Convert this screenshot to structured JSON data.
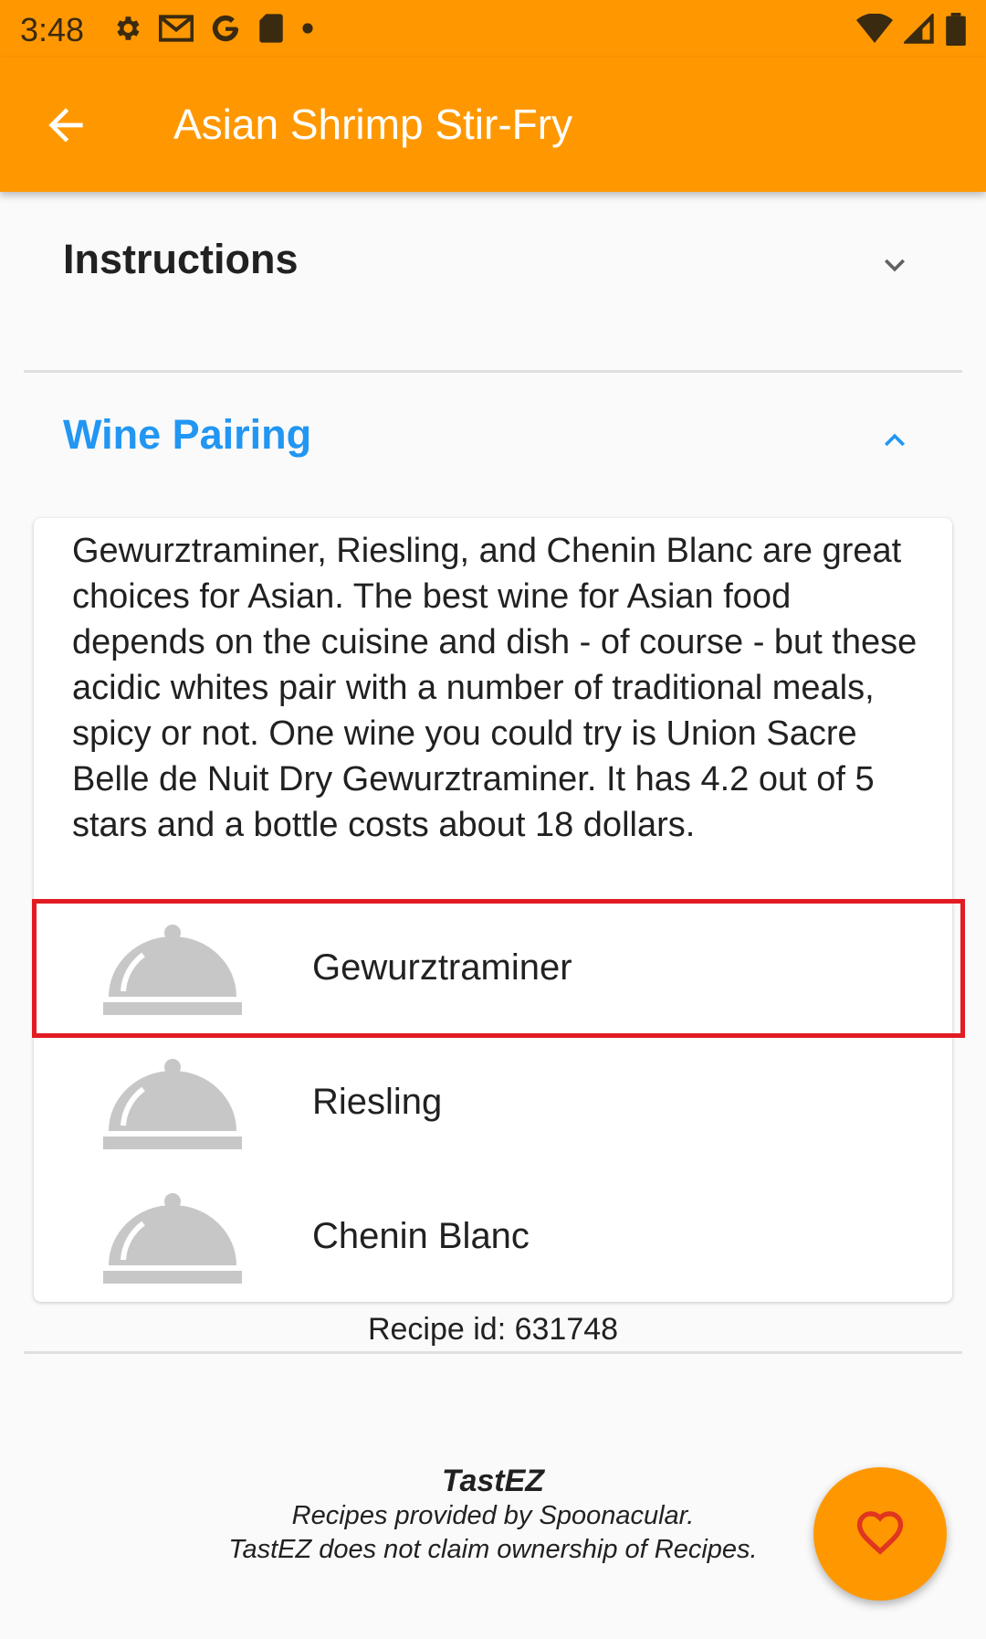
{
  "status_bar": {
    "time": "3:48",
    "icons_left": [
      "gear-icon",
      "gmail-icon",
      "google-icon",
      "sd-card-icon",
      "dot-icon"
    ],
    "icons_right": [
      "wifi-icon",
      "signal-icon",
      "battery-icon"
    ]
  },
  "app_bar": {
    "title": "Asian Shrimp Stir-Fry",
    "back_icon": "arrow-back-icon",
    "color": "#ff9800"
  },
  "sections": {
    "instructions": {
      "label": "Instructions",
      "expanded": false,
      "icon": "chevron-down-icon"
    },
    "wine_pairing": {
      "label": "Wine Pairing",
      "expanded": true,
      "icon": "chevron-up-icon",
      "color": "#2196f3"
    }
  },
  "wine_pairing": {
    "description": "Gewurztraminer, Riesling, and Chenin Blanc are great choices for Asian. The best wine for Asian food depends on the cuisine and dish - of course - but these acidic whites pair with a number of traditional meals, spicy or not. One wine you could try is Union Sacre Belle de Nuit Dry Gewurztraminer. It has 4.2 out of 5 stars and a bottle costs about 18 dollars.",
    "wines": [
      {
        "name": "Gewurztraminer",
        "icon": "cloche-icon"
      },
      {
        "name": "Riesling",
        "icon": "cloche-icon"
      },
      {
        "name": "Chenin Blanc",
        "icon": "cloche-icon"
      }
    ]
  },
  "recipe_id": "Recipe id: 631748",
  "footer": {
    "brand": "TastEZ",
    "line1": "Recipes provided by Spoonacular.",
    "line2": "TastEZ does not claim ownership of Recipes."
  },
  "fab": {
    "icon": "heart-outline-icon",
    "color": "#ff9800"
  }
}
